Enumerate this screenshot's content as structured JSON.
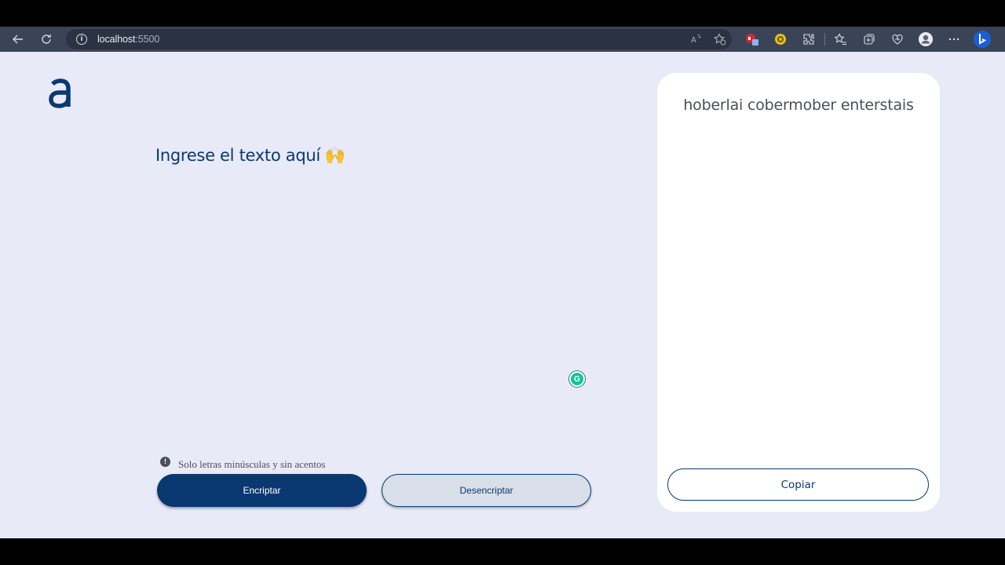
{
  "browser": {
    "url_host": "localhost",
    "url_port": ":5500"
  },
  "main": {
    "prompt": "Ingrese el texto aquí",
    "prompt_emoji": "🙌",
    "hint": "Solo letras minúsculas y sin acentos",
    "encrypt_label": "Encriptar",
    "decrypt_label": "Desencriptar"
  },
  "output": {
    "text": "hoberlai cobermober enterstais",
    "copy_label": "Copiar"
  },
  "colors": {
    "primary": "#0a3871",
    "background": "#e8eaf7",
    "toolbar": "#3b4457"
  }
}
